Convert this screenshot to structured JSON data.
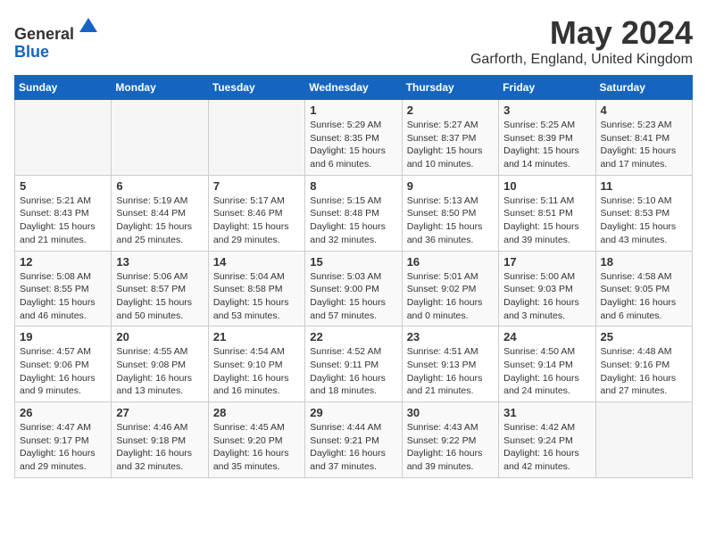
{
  "header": {
    "logo_line1": "General",
    "logo_line2": "Blue",
    "month_title": "May 2024",
    "location": "Garforth, England, United Kingdom"
  },
  "weekdays": [
    "Sunday",
    "Monday",
    "Tuesday",
    "Wednesday",
    "Thursday",
    "Friday",
    "Saturday"
  ],
  "weeks": [
    [
      {
        "day": "",
        "detail": ""
      },
      {
        "day": "",
        "detail": ""
      },
      {
        "day": "",
        "detail": ""
      },
      {
        "day": "1",
        "detail": "Sunrise: 5:29 AM\nSunset: 8:35 PM\nDaylight: 15 hours\nand 6 minutes."
      },
      {
        "day": "2",
        "detail": "Sunrise: 5:27 AM\nSunset: 8:37 PM\nDaylight: 15 hours\nand 10 minutes."
      },
      {
        "day": "3",
        "detail": "Sunrise: 5:25 AM\nSunset: 8:39 PM\nDaylight: 15 hours\nand 14 minutes."
      },
      {
        "day": "4",
        "detail": "Sunrise: 5:23 AM\nSunset: 8:41 PM\nDaylight: 15 hours\nand 17 minutes."
      }
    ],
    [
      {
        "day": "5",
        "detail": "Sunrise: 5:21 AM\nSunset: 8:43 PM\nDaylight: 15 hours\nand 21 minutes."
      },
      {
        "day": "6",
        "detail": "Sunrise: 5:19 AM\nSunset: 8:44 PM\nDaylight: 15 hours\nand 25 minutes."
      },
      {
        "day": "7",
        "detail": "Sunrise: 5:17 AM\nSunset: 8:46 PM\nDaylight: 15 hours\nand 29 minutes."
      },
      {
        "day": "8",
        "detail": "Sunrise: 5:15 AM\nSunset: 8:48 PM\nDaylight: 15 hours\nand 32 minutes."
      },
      {
        "day": "9",
        "detail": "Sunrise: 5:13 AM\nSunset: 8:50 PM\nDaylight: 15 hours\nand 36 minutes."
      },
      {
        "day": "10",
        "detail": "Sunrise: 5:11 AM\nSunset: 8:51 PM\nDaylight: 15 hours\nand 39 minutes."
      },
      {
        "day": "11",
        "detail": "Sunrise: 5:10 AM\nSunset: 8:53 PM\nDaylight: 15 hours\nand 43 minutes."
      }
    ],
    [
      {
        "day": "12",
        "detail": "Sunrise: 5:08 AM\nSunset: 8:55 PM\nDaylight: 15 hours\nand 46 minutes."
      },
      {
        "day": "13",
        "detail": "Sunrise: 5:06 AM\nSunset: 8:57 PM\nDaylight: 15 hours\nand 50 minutes."
      },
      {
        "day": "14",
        "detail": "Sunrise: 5:04 AM\nSunset: 8:58 PM\nDaylight: 15 hours\nand 53 minutes."
      },
      {
        "day": "15",
        "detail": "Sunrise: 5:03 AM\nSunset: 9:00 PM\nDaylight: 15 hours\nand 57 minutes."
      },
      {
        "day": "16",
        "detail": "Sunrise: 5:01 AM\nSunset: 9:02 PM\nDaylight: 16 hours\nand 0 minutes."
      },
      {
        "day": "17",
        "detail": "Sunrise: 5:00 AM\nSunset: 9:03 PM\nDaylight: 16 hours\nand 3 minutes."
      },
      {
        "day": "18",
        "detail": "Sunrise: 4:58 AM\nSunset: 9:05 PM\nDaylight: 16 hours\nand 6 minutes."
      }
    ],
    [
      {
        "day": "19",
        "detail": "Sunrise: 4:57 AM\nSunset: 9:06 PM\nDaylight: 16 hours\nand 9 minutes."
      },
      {
        "day": "20",
        "detail": "Sunrise: 4:55 AM\nSunset: 9:08 PM\nDaylight: 16 hours\nand 13 minutes."
      },
      {
        "day": "21",
        "detail": "Sunrise: 4:54 AM\nSunset: 9:10 PM\nDaylight: 16 hours\nand 16 minutes."
      },
      {
        "day": "22",
        "detail": "Sunrise: 4:52 AM\nSunset: 9:11 PM\nDaylight: 16 hours\nand 18 minutes."
      },
      {
        "day": "23",
        "detail": "Sunrise: 4:51 AM\nSunset: 9:13 PM\nDaylight: 16 hours\nand 21 minutes."
      },
      {
        "day": "24",
        "detail": "Sunrise: 4:50 AM\nSunset: 9:14 PM\nDaylight: 16 hours\nand 24 minutes."
      },
      {
        "day": "25",
        "detail": "Sunrise: 4:48 AM\nSunset: 9:16 PM\nDaylight: 16 hours\nand 27 minutes."
      }
    ],
    [
      {
        "day": "26",
        "detail": "Sunrise: 4:47 AM\nSunset: 9:17 PM\nDaylight: 16 hours\nand 29 minutes."
      },
      {
        "day": "27",
        "detail": "Sunrise: 4:46 AM\nSunset: 9:18 PM\nDaylight: 16 hours\nand 32 minutes."
      },
      {
        "day": "28",
        "detail": "Sunrise: 4:45 AM\nSunset: 9:20 PM\nDaylight: 16 hours\nand 35 minutes."
      },
      {
        "day": "29",
        "detail": "Sunrise: 4:44 AM\nSunset: 9:21 PM\nDaylight: 16 hours\nand 37 minutes."
      },
      {
        "day": "30",
        "detail": "Sunrise: 4:43 AM\nSunset: 9:22 PM\nDaylight: 16 hours\nand 39 minutes."
      },
      {
        "day": "31",
        "detail": "Sunrise: 4:42 AM\nSunset: 9:24 PM\nDaylight: 16 hours\nand 42 minutes."
      },
      {
        "day": "",
        "detail": ""
      }
    ]
  ]
}
